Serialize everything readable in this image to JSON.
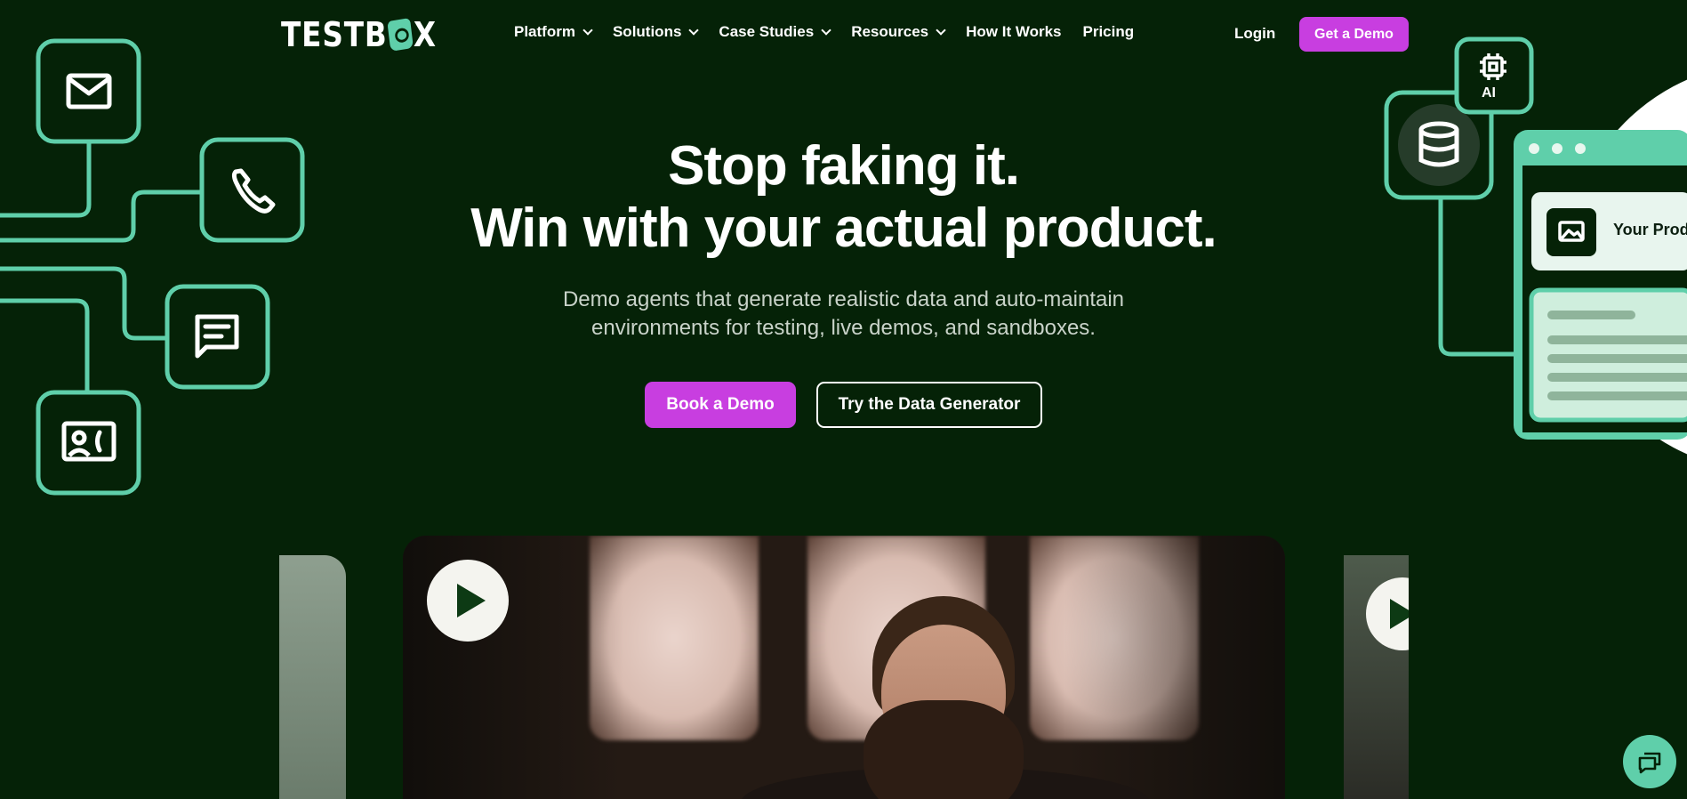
{
  "brand": {
    "logo_text_a": "TESTB",
    "logo_text_b": "X"
  },
  "nav": {
    "items": [
      {
        "label": "Platform",
        "dropdown": true
      },
      {
        "label": "Solutions",
        "dropdown": true
      },
      {
        "label": "Case Studies",
        "dropdown": true
      },
      {
        "label": "Resources",
        "dropdown": true
      },
      {
        "label": "How It Works",
        "dropdown": false
      },
      {
        "label": "Pricing",
        "dropdown": false
      }
    ],
    "login_label": "Login",
    "cta_label": "Get a Demo"
  },
  "hero": {
    "title_line1": "Stop faking it.",
    "title_line2": "Win with your actual product.",
    "subtitle_line1": "Demo agents that generate realistic data and auto-maintain",
    "subtitle_line2": "environments for testing, live demos, and sandboxes.",
    "primary_cta": "Book a Demo",
    "secondary_cta": "Try the Data Generator"
  },
  "illustration": {
    "ai_label": "AI",
    "product_card_text": "Your Prod"
  },
  "colors": {
    "background": "#052207",
    "accent_green": "#5fcfaa",
    "accent_purple": "#c83ee0"
  },
  "icons": [
    "mail-icon",
    "phone-icon",
    "chat-icon",
    "contact-card-icon",
    "database-icon",
    "chip-icon",
    "image-icon",
    "play-icon",
    "chat-launcher-icon",
    "chevron-down-icon"
  ]
}
